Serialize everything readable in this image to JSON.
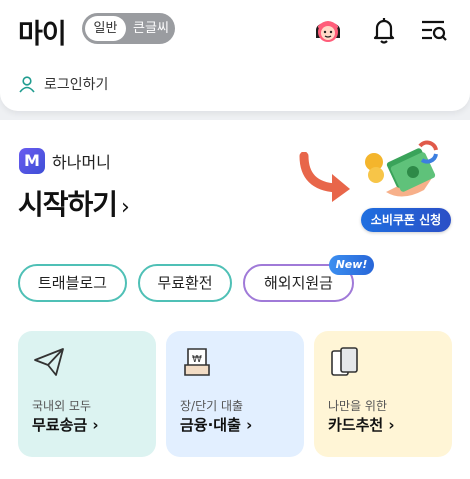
{
  "header": {
    "title": "마이",
    "mode_normal": "일반",
    "mode_large": "큰글씨",
    "login_label": "로그인하기"
  },
  "promo": {
    "brand_label": "하나머니",
    "brand_logo": "M",
    "headline": "시작하기",
    "coupon_label": "소비쿠폰 신청"
  },
  "chips": [
    {
      "label": "트래블로그"
    },
    {
      "label": "무료환전"
    },
    {
      "label": "해외지원금"
    }
  ],
  "new_badge": "New!",
  "cards": [
    {
      "sub": "국내외 모두",
      "label": "무료송금",
      "color": "#dcf3f1"
    },
    {
      "sub": "장/단기 대출",
      "label": "금융·대출",
      "color": "#e2efff"
    },
    {
      "sub": "나만을 위한",
      "label": "카드추천",
      "color": "#fff5d6"
    }
  ],
  "icons": {
    "avatar": "avatar-icon",
    "bell": "bell-icon",
    "menu": "menu-search-icon",
    "user": "user-icon",
    "send": "paper-plane-icon",
    "loan": "won-document-icon",
    "card": "cards-icon"
  }
}
